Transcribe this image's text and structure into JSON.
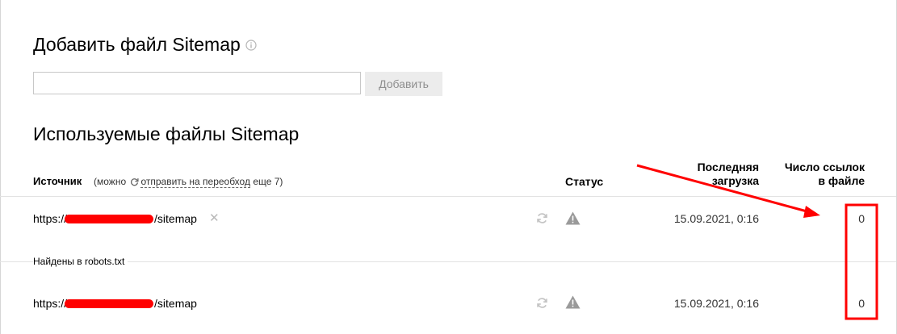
{
  "add_section": {
    "title": "Добавить файл Sitemap",
    "input_value": "",
    "button_label": "Добавить"
  },
  "used_section": {
    "title": "Используемые файлы Sitemap",
    "columns": {
      "source": "Источник",
      "note_prefix": "(можно",
      "note_link": "отправить на переобход",
      "note_suffix": "еще 7)",
      "status": "Статус",
      "last_upload_line1": "Последняя",
      "last_upload_line2": "загрузка",
      "links_count_line1": "Число ссылок",
      "links_count_line2": "в файле"
    },
    "rows": [
      {
        "url_prefix": "https://",
        "url_suffix": "/sitemap",
        "date": "15.09.2021, 0:16",
        "count": "0"
      },
      {
        "url_prefix": "https://",
        "url_suffix": "/sitemap",
        "date": "15.09.2021, 0:16",
        "count": "0"
      }
    ],
    "group_label": "Найдены в robots.txt"
  },
  "colors": {
    "annotation_red": "#ff0000",
    "button_bg": "#ececec",
    "icon_gray": "#b5b5b5"
  },
  "icons": [
    "info-icon",
    "refresh-icon",
    "warning-icon",
    "remove-icon"
  ]
}
